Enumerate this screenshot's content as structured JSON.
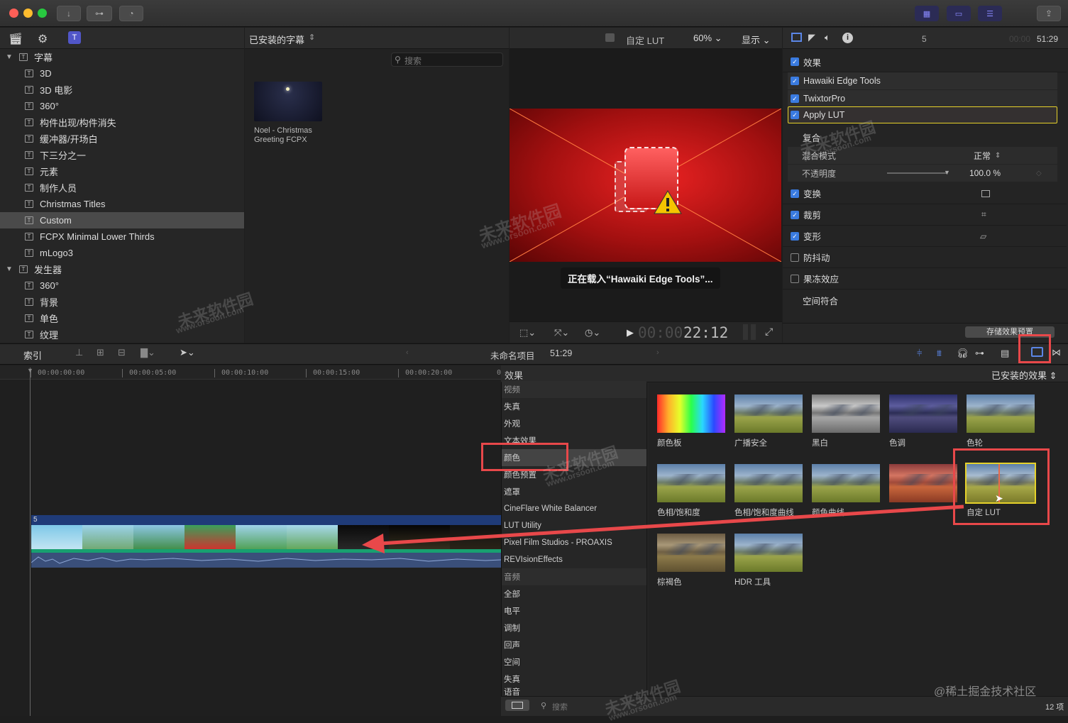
{
  "titlebar": {
    "buttons": [
      "download-icon",
      "key-icon",
      "clock-icon",
      "share-icon"
    ]
  },
  "library": {
    "header_title": "已安装的字幕",
    "search_placeholder": "搜索",
    "items": [
      {
        "label": "字幕",
        "kind": "group"
      },
      {
        "label": "3D",
        "kind": "item"
      },
      {
        "label": "3D 电影",
        "kind": "item"
      },
      {
        "label": "360°",
        "kind": "item"
      },
      {
        "label": "构件出现/构件消失",
        "kind": "item"
      },
      {
        "label": "缓冲器/开场白",
        "kind": "item"
      },
      {
        "label": "下三分之一",
        "kind": "item"
      },
      {
        "label": "元素",
        "kind": "item"
      },
      {
        "label": "制作人员",
        "kind": "item"
      },
      {
        "label": "Christmas Titles",
        "kind": "item"
      },
      {
        "label": "Custom",
        "kind": "item",
        "selected": true
      },
      {
        "label": "FCPX Minimal Lower Thirds",
        "kind": "item"
      },
      {
        "label": "mLogo3",
        "kind": "item"
      },
      {
        "label": "发生器",
        "kind": "group"
      },
      {
        "label": "360°",
        "kind": "item"
      },
      {
        "label": "背景",
        "kind": "item"
      },
      {
        "label": "单色",
        "kind": "item"
      },
      {
        "label": "纹理",
        "kind": "item"
      }
    ],
    "clip_name": "Noel - Christmas Greeting FCPX"
  },
  "viewer": {
    "lut_label": "自定 LUT",
    "zoom": "60%",
    "display_label": "显示",
    "loading_text": "正在载入“Hawaiki Edge Tools”...",
    "timecode_dim": "00:00",
    "timecode": "22:12"
  },
  "inspector": {
    "clip_count": "5",
    "timecode_dim": "00:00",
    "timecode": "51:29",
    "effects_label": "效果",
    "effects": [
      "Hawaiki Edge Tools",
      "TwixtorPro",
      "Apply LUT"
    ],
    "composite_label": "复合",
    "blend_mode_label": "混合模式",
    "blend_mode_value": "正常",
    "opacity_label": "不透明度",
    "opacity_value": "100.0 %",
    "opacity_level": 1.0,
    "transform_label": "变换",
    "crop_label": "裁剪",
    "distort_label": "变形",
    "stabilize_label": "防抖动",
    "rolling_shutter_label": "果冻效应",
    "spatial_conform_label": "空间符合",
    "save_preset_label": "存储效果预置"
  },
  "timeline": {
    "index_label": "索引",
    "project_name": "未命名项目",
    "project_duration": "51:29",
    "ruler": [
      "00:00:00:00",
      "00:00:05:00",
      "00:00:10:00",
      "00:00:15:00",
      "00:00:20:00"
    ],
    "ruler_overflow": "0",
    "clip_index": "5"
  },
  "effects_browser": {
    "header": "效果",
    "installed_label": "已安装的效果",
    "categories": [
      {
        "label": "视频",
        "header": true
      },
      {
        "label": "失真"
      },
      {
        "label": "外观"
      },
      {
        "label": "文本效果"
      },
      {
        "label": "颜色",
        "selected": true
      },
      {
        "label": "颜色预置"
      },
      {
        "label": "遮罩"
      },
      {
        "label": "CineFlare White Balancer"
      },
      {
        "label": "LUT Utility"
      },
      {
        "label": "Pixel Film Studios - PROAXIS"
      },
      {
        "label": "REVIsionEffects"
      },
      {
        "label": "音频",
        "header": true
      },
      {
        "label": "全部"
      },
      {
        "label": "电平"
      },
      {
        "label": "调制"
      },
      {
        "label": "回声"
      },
      {
        "label": "空间"
      },
      {
        "label": "失真"
      },
      {
        "label": "语音"
      }
    ],
    "effects": [
      {
        "label": "颜色板",
        "style": "rainbow"
      },
      {
        "label": "广播安全",
        "style": "normal"
      },
      {
        "label": "黑白",
        "style": "bw"
      },
      {
        "label": "色调",
        "style": "tint"
      },
      {
        "label": "色轮",
        "style": "normal"
      },
      {
        "label": "色相/饱和度",
        "style": "normal"
      },
      {
        "label": "色相/饱和度曲线",
        "style": "normal"
      },
      {
        "label": "颜色曲线",
        "style": "normal"
      },
      {
        "label": "",
        "style": "red"
      },
      {
        "label": "自定 LUT",
        "style": "lut",
        "selected": true
      },
      {
        "label": "棕褐色",
        "style": "sepia"
      },
      {
        "label": "HDR 工具",
        "style": "normal"
      }
    ],
    "search_placeholder": "搜索",
    "count_label": "12 项"
  },
  "watermark": {
    "brand": "未来软件园",
    "url": "www.orsoon.com",
    "footer": "@稀土掘金技术社区"
  },
  "colors": {
    "accent": "#3a7be0",
    "highlight": "#e8484a",
    "selection_yellow": "#e6d22a"
  }
}
